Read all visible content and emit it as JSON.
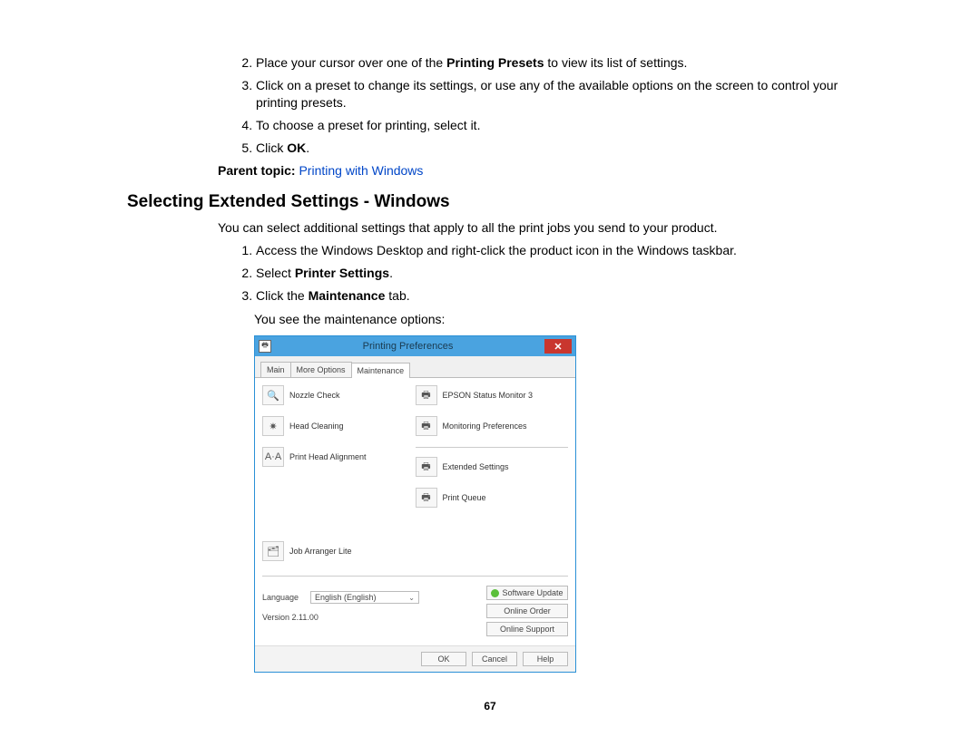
{
  "top_list": {
    "start": 2,
    "items": [
      {
        "pre": "Place your cursor over one of the ",
        "bold": "Printing Presets",
        "post": " to view its list of settings."
      },
      {
        "text": "Click on a preset to change its settings, or use any of the available options on the screen to control your printing presets."
      },
      {
        "text": "To choose a preset for printing, select it."
      },
      {
        "pre": "Click ",
        "bold": "OK",
        "post": "."
      }
    ]
  },
  "parent_topic": {
    "label": "Parent topic:",
    "link": "Printing with Windows"
  },
  "heading": "Selecting Extended Settings - Windows",
  "intro": "You can select additional settings that apply to all the print jobs you send to your product.",
  "second_list": {
    "start": 1,
    "items": [
      {
        "text": "Access the Windows Desktop and right-click the product icon in the Windows taskbar."
      },
      {
        "pre": "Select ",
        "bold": "Printer Settings",
        "post": "."
      },
      {
        "pre": "Click the ",
        "bold": "Maintenance",
        "post": " tab."
      }
    ]
  },
  "after_list": "You see the maintenance options:",
  "dialog": {
    "title": "Printing Preferences",
    "tabs": [
      "Main",
      "More Options",
      "Maintenance"
    ],
    "active_tab": 2,
    "left_items": [
      {
        "icon": "🔍",
        "label": "Nozzle Check"
      },
      {
        "icon": "✷",
        "label": "Head Cleaning"
      },
      {
        "icon": "A·A",
        "label": "Print Head Alignment"
      }
    ],
    "right_items_top": [
      {
        "icon": "🖶",
        "label": "EPSON Status Monitor 3"
      },
      {
        "icon": "🖶",
        "label": "Monitoring Preferences"
      }
    ],
    "right_items_mid": [
      {
        "icon": "🖶",
        "label": "Extended Settings"
      },
      {
        "icon": "🖶",
        "label": "Print Queue"
      }
    ],
    "left_bottom": {
      "icon": "🗂",
      "label": "Job Arranger Lite"
    },
    "language_label": "Language",
    "language_value": "English (English)",
    "version": "Version 2.11.00",
    "right_buttons": [
      "Software Update",
      "Online Order",
      "Online Support"
    ],
    "bottom_buttons": [
      "OK",
      "Cancel",
      "Help"
    ]
  },
  "page_number": "67"
}
